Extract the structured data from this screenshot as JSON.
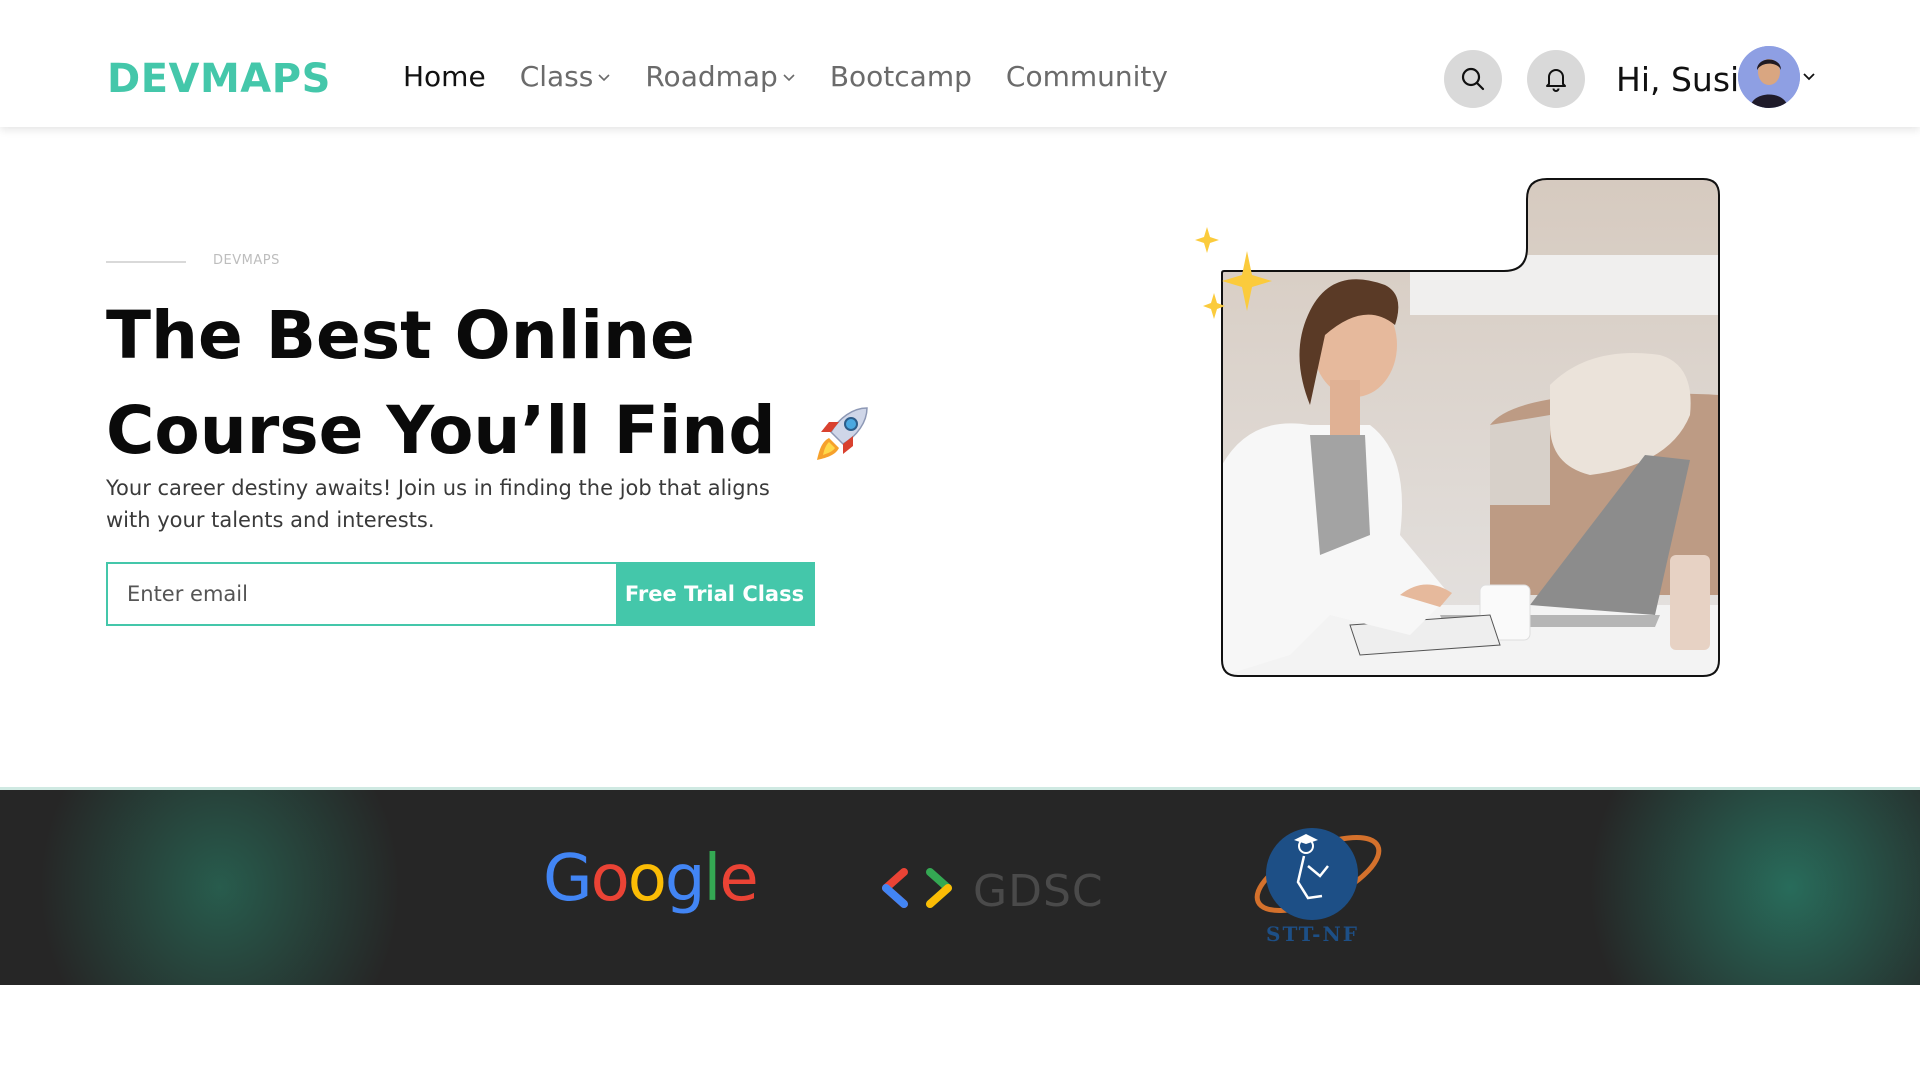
{
  "header": {
    "logo": "DEVMAPS",
    "nav": [
      {
        "label": "Home",
        "active": true,
        "has_dropdown": false
      },
      {
        "label": "Class",
        "active": false,
        "has_dropdown": true
      },
      {
        "label": "Roadmap",
        "active": false,
        "has_dropdown": true
      },
      {
        "label": "Bootcamp",
        "active": false,
        "has_dropdown": false
      },
      {
        "label": "Community",
        "active": false,
        "has_dropdown": false
      }
    ],
    "search_icon": "search-icon",
    "notification_icon": "bell-icon",
    "greeting": "Hi, Susi",
    "avatar_menu_icon": "chevron-down-icon"
  },
  "hero": {
    "eyebrow": "DEVMAPS",
    "title_line1": "The Best Online",
    "title_line2": "Course You’ll Find",
    "title_icon": "rocket-icon",
    "description": "Your career destiny awaits! Join us in finding the job that aligns with your talents and interests.",
    "email_placeholder": "Enter email",
    "cta_label": "Free Trial Class",
    "decoration_icon": "sparkles-icon"
  },
  "partners": {
    "google": "Google",
    "gdsc": "GDSC",
    "sttnf": "STT-NF"
  },
  "colors": {
    "accent": "#44c7aa",
    "strip_background": "#262626",
    "strip_glow": "#2e7a66",
    "google_blue": "#4285f4",
    "google_red": "#ea4335",
    "google_yellow": "#fbbc05",
    "google_green": "#34a853"
  }
}
